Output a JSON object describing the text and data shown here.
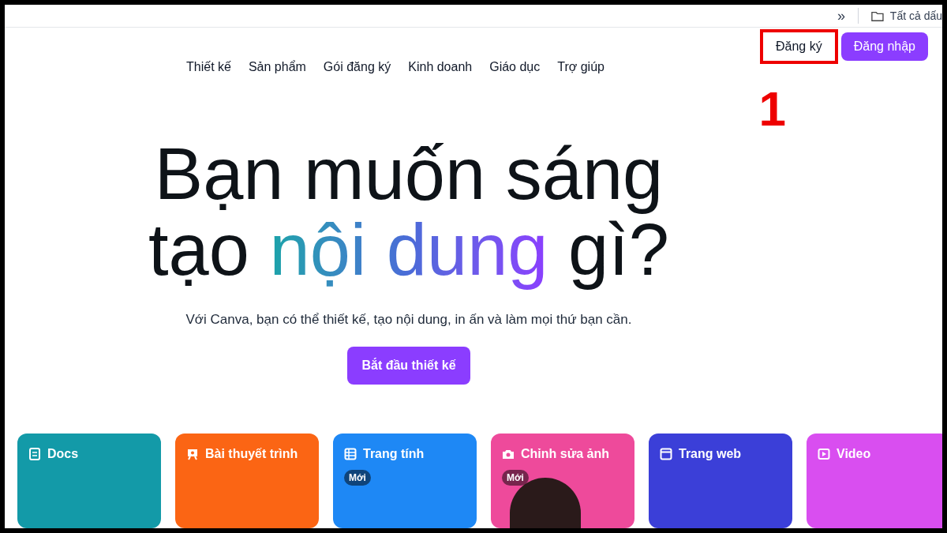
{
  "bookmarks_bar": {
    "overflow": "»",
    "folder_label": "Tất cả dấu"
  },
  "nav": {
    "items": [
      "Thiết kế",
      "Sản phẩm",
      "Gói đăng ký",
      "Kinh doanh",
      "Giáo dục",
      "Trợ giúp"
    ],
    "signup": {
      "label": "Đăng ký",
      "highlighted": true
    },
    "login": "Đăng nhập"
  },
  "annotation": {
    "number": "1"
  },
  "hero": {
    "headline": [
      [
        {
          "text": "Bạn muốn sáng",
          "gradient": false
        }
      ],
      [
        {
          "text": "tạo ",
          "gradient": false
        },
        {
          "text": "nội dung",
          "gradient": true
        },
        {
          "text": " gì?",
          "gradient": false
        }
      ]
    ],
    "subtitle": "Với Canva, bạn có thể thiết kế, tạo nội dung, in ấn và làm mọi thứ bạn cần.",
    "cta": "Bắt đầu thiết kế"
  },
  "cards": [
    {
      "kind": "docs",
      "title": "Docs",
      "color": "#139aa8"
    },
    {
      "kind": "presentation",
      "title": "Bài thuyết trình",
      "color": "#fb6514"
    },
    {
      "kind": "sheet",
      "title": "Trang tính",
      "badge": "Mới",
      "color": "#1e88f5"
    },
    {
      "kind": "photo",
      "title": "Chỉnh sửa ảnh",
      "badge": "Mới",
      "color": "#ee4a9b"
    },
    {
      "kind": "web",
      "title": "Trang web",
      "color": "#3b3fd8"
    },
    {
      "kind": "video",
      "title": "Video",
      "color": "#d94ef0"
    }
  ]
}
